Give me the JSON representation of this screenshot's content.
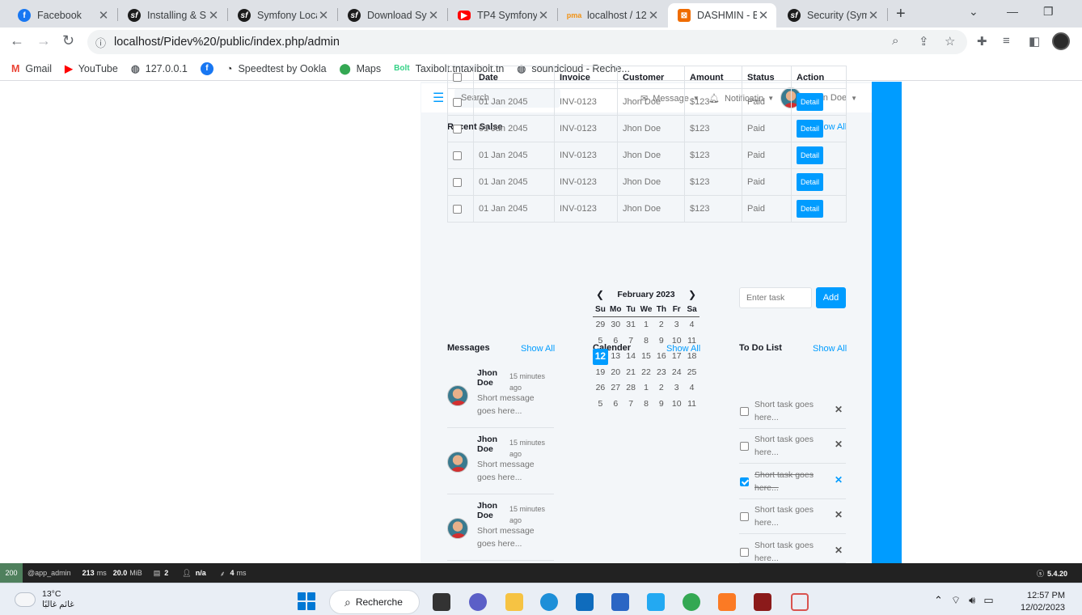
{
  "tabs": [
    {
      "title": "Facebook",
      "icon": "facebook-icon"
    },
    {
      "title": "Installing & S",
      "icon": "symfony-icon"
    },
    {
      "title": "Symfony Loca",
      "icon": "symfony-icon"
    },
    {
      "title": "Download Sy",
      "icon": "symfony-icon"
    },
    {
      "title": "TP4 Symfony",
      "icon": "youtube-icon"
    },
    {
      "title": "localhost / 12",
      "icon": "phpmyadmin-icon"
    },
    {
      "title": "DASHMIN - B",
      "icon": "dashmin-icon"
    },
    {
      "title": "Security (Sym",
      "icon": "symfony-icon"
    }
  ],
  "address_bar": {
    "url": "localhost/Pidev%20/public/index.php/admin"
  },
  "bookmarks": [
    {
      "label": "Gmail",
      "icon": "gmail-icon"
    },
    {
      "label": "YouTube",
      "icon": "youtube-icon"
    },
    {
      "label": "127.0.0.1",
      "icon": "globe-icon"
    },
    {
      "label": "",
      "icon": "facebook-icon"
    },
    {
      "label": "Speedtest by Ookla",
      "icon": "speedtest-icon"
    },
    {
      "label": "Maps",
      "icon": "maps-icon"
    },
    {
      "label": "Taxibolt.tntaxibolt.tn",
      "icon": "bolt-icon"
    },
    {
      "label": "soundcloud - Reche...",
      "icon": "globe-icon"
    }
  ],
  "topnav": {
    "search_placeholder": "Search",
    "message": "Message",
    "notification": "Notificatin",
    "user": "John Doe"
  },
  "sales": {
    "title": "Recent Salse",
    "show_all": "Show All",
    "columns": [
      "Date",
      "Invoice",
      "Customer",
      "Amount",
      "Status",
      "Action"
    ],
    "rows": [
      {
        "date": "01 Jan 2045",
        "invoice": "INV-0123",
        "customer": "Jhon Doe",
        "amount": "$123",
        "status": "Paid",
        "action": "Detail"
      },
      {
        "date": "01 Jan 2045",
        "invoice": "INV-0123",
        "customer": "Jhon Doe",
        "amount": "$123",
        "status": "Paid",
        "action": "Detail"
      },
      {
        "date": "01 Jan 2045",
        "invoice": "INV-0123",
        "customer": "Jhon Doe",
        "amount": "$123",
        "status": "Paid",
        "action": "Detail"
      },
      {
        "date": "01 Jan 2045",
        "invoice": "INV-0123",
        "customer": "Jhon Doe",
        "amount": "$123",
        "status": "Paid",
        "action": "Detail"
      },
      {
        "date": "01 Jan 2045",
        "invoice": "INV-0123",
        "customer": "Jhon Doe",
        "amount": "$123",
        "status": "Paid",
        "action": "Detail"
      }
    ]
  },
  "messages": {
    "title": "Messages",
    "show_all": "Show All",
    "items": [
      {
        "name": "Jhon Doe",
        "time": "15 minutes ago",
        "text": "Short message goes here..."
      },
      {
        "name": "Jhon Doe",
        "time": "15 minutes ago",
        "text": "Short message goes here..."
      },
      {
        "name": "Jhon Doe",
        "time": "15 minutes ago",
        "text": "Short message goes here..."
      }
    ]
  },
  "calendar": {
    "title": "Calender",
    "show_all": "Show All",
    "month": "February 2023",
    "weekdays": [
      "Su",
      "Mo",
      "Tu",
      "We",
      "Th",
      "Fr",
      "Sa"
    ],
    "days": [
      "29",
      "30",
      "31",
      "1",
      "2",
      "3",
      "4",
      "5",
      "6",
      "7",
      "8",
      "9",
      "10",
      "11",
      "12",
      "13",
      "14",
      "15",
      "16",
      "17",
      "18",
      "19",
      "20",
      "21",
      "22",
      "23",
      "24",
      "25",
      "26",
      "27",
      "28",
      "1",
      "2",
      "3",
      "4",
      "5",
      "6",
      "7",
      "8",
      "9",
      "10",
      "11"
    ],
    "today": "12"
  },
  "todo": {
    "title": "To Do List",
    "show_all": "Show All",
    "input_placeholder": "Enter task",
    "add_label": "Add",
    "items": [
      {
        "text": "Short task goes here...",
        "done": false
      },
      {
        "text": "Short task goes here...",
        "done": false
      },
      {
        "text": "Short task goes here...",
        "done": true
      },
      {
        "text": "Short task goes here...",
        "done": false
      },
      {
        "text": "Short task goes here...",
        "done": false
      }
    ]
  },
  "debug_toolbar": {
    "status": "200",
    "route": "@app_admin",
    "time_value": "213",
    "time_unit": "ms",
    "memory_value": "20.0",
    "memory_unit": "MiB",
    "db_queries": "2",
    "user": "n/a",
    "twig_value": "4",
    "twig_unit": "ms",
    "symfony_version": "5.4.20"
  },
  "taskbar": {
    "temperature": "13°C",
    "weather_text": "غائم غالبًا",
    "search_label": "Recherche",
    "time": "12:57 PM",
    "date": "12/02/2023"
  },
  "colors": {
    "accent": "#009cff",
    "panel_bg": "#f3f6f9",
    "debug_bg": "#222222",
    "status_ok": "#4f805d"
  }
}
